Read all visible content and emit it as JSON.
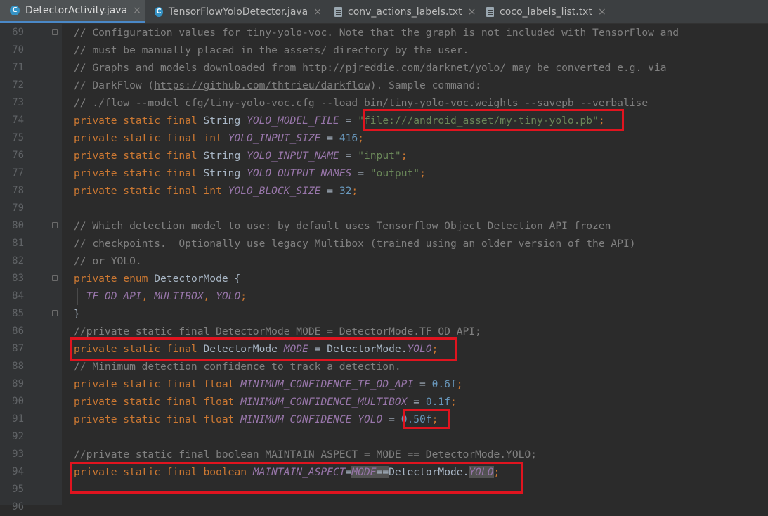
{
  "tabs": [
    {
      "label": "DetectorActivity.java",
      "icon": "java-class-icon",
      "active": true
    },
    {
      "label": "TensorFlowYoloDetector.java",
      "icon": "java-class-icon",
      "active": false
    },
    {
      "label": "conv_actions_labels.txt",
      "icon": "text-file-icon",
      "active": false
    },
    {
      "label": "coco_labels_list.txt",
      "icon": "text-file-icon",
      "active": false
    }
  ],
  "close_glyph": "×",
  "class_icon_letter": "C",
  "editor": {
    "lines": [
      {
        "n": "69",
        "tokens": [
          [
            "cm",
            "// Configuration values for tiny-yolo-voc. Note that the graph is not included with TensorFlow and"
          ]
        ]
      },
      {
        "n": "70",
        "tokens": [
          [
            "cm",
            "// must be manually placed in the assets/ directory by the user."
          ]
        ]
      },
      {
        "n": "71",
        "tokens": [
          [
            "cm",
            "// Graphs and models downloaded from "
          ],
          [
            "cm ul",
            "http://pjreddie.com/darknet/yolo/"
          ],
          [
            "cm",
            " may be converted e.g. via"
          ]
        ]
      },
      {
        "n": "72",
        "tokens": [
          [
            "cm",
            "// DarkFlow ("
          ],
          [
            "cm ul",
            "https://github.com/thtrieu/darkflow"
          ],
          [
            "cm",
            "). Sample command:"
          ]
        ]
      },
      {
        "n": "73",
        "tokens": [
          [
            "cm",
            "// ./flow --model cfg/tiny-yolo-voc.cfg --load bin/tiny-yolo-voc.weights --savepb --verbalise"
          ]
        ]
      },
      {
        "n": "74",
        "tokens": [
          [
            "kw",
            "private static final "
          ],
          [
            "",
            "String "
          ],
          [
            "fld",
            "YOLO_MODEL_FILE"
          ],
          [
            "",
            " = "
          ],
          [
            "st",
            "\"file:///android_asset/my-tiny-yolo.pb\""
          ],
          [
            "kw",
            ";"
          ]
        ]
      },
      {
        "n": "75",
        "tokens": [
          [
            "kw",
            "private static final int "
          ],
          [
            "fld",
            "YOLO_INPUT_SIZE"
          ],
          [
            "",
            " = "
          ],
          [
            "nm",
            "416"
          ],
          [
            "kw",
            ";"
          ]
        ]
      },
      {
        "n": "76",
        "tokens": [
          [
            "kw",
            "private static final "
          ],
          [
            "",
            "String "
          ],
          [
            "fld",
            "YOLO_INPUT_NAME"
          ],
          [
            "",
            " = "
          ],
          [
            "st",
            "\"input\""
          ],
          [
            "kw",
            ";"
          ]
        ]
      },
      {
        "n": "77",
        "tokens": [
          [
            "kw",
            "private static final "
          ],
          [
            "",
            "String "
          ],
          [
            "fld",
            "YOLO_OUTPUT_NAMES"
          ],
          [
            "",
            " = "
          ],
          [
            "st",
            "\"output\""
          ],
          [
            "kw",
            ";"
          ]
        ]
      },
      {
        "n": "78",
        "tokens": [
          [
            "kw",
            "private static final int "
          ],
          [
            "fld",
            "YOLO_BLOCK_SIZE"
          ],
          [
            "",
            " = "
          ],
          [
            "nm",
            "32"
          ],
          [
            "kw",
            ";"
          ]
        ]
      },
      {
        "n": "79",
        "tokens": []
      },
      {
        "n": "80",
        "tokens": [
          [
            "cm",
            "// Which detection model to use: by default uses Tensorflow Object Detection API frozen"
          ]
        ]
      },
      {
        "n": "81",
        "tokens": [
          [
            "cm",
            "// checkpoints.  Optionally use legacy Multibox (trained using an older version of the API)"
          ]
        ]
      },
      {
        "n": "82",
        "tokens": [
          [
            "cm",
            "// or YOLO."
          ]
        ]
      },
      {
        "n": "83",
        "tokens": [
          [
            "kw",
            "private enum "
          ],
          [
            "",
            "DetectorMode {"
          ]
        ]
      },
      {
        "n": "84",
        "tokens": [
          [
            "",
            "  "
          ],
          [
            "fld",
            "TF_OD_API"
          ],
          [
            "kw",
            ", "
          ],
          [
            "fld",
            "MULTIBOX"
          ],
          [
            "kw",
            ", "
          ],
          [
            "fld",
            "YOLO"
          ],
          [
            "kw",
            ";"
          ]
        ]
      },
      {
        "n": "85",
        "tokens": [
          [
            "",
            "}"
          ]
        ]
      },
      {
        "n": "86",
        "tokens": [
          [
            "cm",
            "//private static final DetectorMode MODE = DetectorMode.TF_OD_API;"
          ]
        ]
      },
      {
        "n": "87",
        "tokens": [
          [
            "kw",
            "private static final "
          ],
          [
            "",
            "DetectorMode "
          ],
          [
            "fld",
            "MODE"
          ],
          [
            "",
            " = DetectorMode."
          ],
          [
            "fld",
            "YOLO"
          ],
          [
            "kw",
            ";"
          ]
        ]
      },
      {
        "n": "88",
        "tokens": [
          [
            "cm",
            "// Minimum detection confidence to track a detection."
          ]
        ]
      },
      {
        "n": "89",
        "tokens": [
          [
            "kw",
            "private static final float "
          ],
          [
            "fld",
            "MINIMUM_CONFIDENCE_TF_OD_API"
          ],
          [
            "",
            " = "
          ],
          [
            "nm",
            "0.6f"
          ],
          [
            "kw",
            ";"
          ]
        ]
      },
      {
        "n": "90",
        "tokens": [
          [
            "kw",
            "private static final float "
          ],
          [
            "fld",
            "MINIMUM_CONFIDENCE_MULTIBOX"
          ],
          [
            "",
            " = "
          ],
          [
            "nm",
            "0.1f"
          ],
          [
            "kw",
            ";"
          ]
        ]
      },
      {
        "n": "91",
        "tokens": [
          [
            "kw",
            "private static final float "
          ],
          [
            "fld",
            "MINIMUM_CONFIDENCE_YOLO"
          ],
          [
            "",
            " = "
          ],
          [
            "nm",
            "0.50f"
          ],
          [
            "kw",
            ";"
          ]
        ]
      },
      {
        "n": "92",
        "tokens": []
      },
      {
        "n": "93",
        "tokens": [
          [
            "cm",
            "//private static final boolean MAINTAIN_ASPECT = MODE == DetectorMode.YOLO;"
          ]
        ]
      },
      {
        "n": "94",
        "tokens": [
          [
            "kw",
            "private static final boolean "
          ],
          [
            "fld",
            "MAINTAIN_ASPECT"
          ],
          [
            "",
            "="
          ],
          [
            "fld hl",
            "MODE"
          ],
          [
            "hl",
            "=="
          ],
          [
            "",
            "DetectorMode."
          ],
          [
            "fld hl",
            "YOLO"
          ],
          [
            "kw",
            ";"
          ]
        ]
      },
      {
        "n": "95",
        "tokens": []
      },
      {
        "n": "96",
        "tokens": []
      }
    ]
  },
  "colors": {
    "keyword": "#cc7832",
    "comment": "#808080",
    "string": "#6a8759",
    "number": "#6897bb",
    "field": "#9876aa",
    "annotation_box": "#e0141f"
  }
}
